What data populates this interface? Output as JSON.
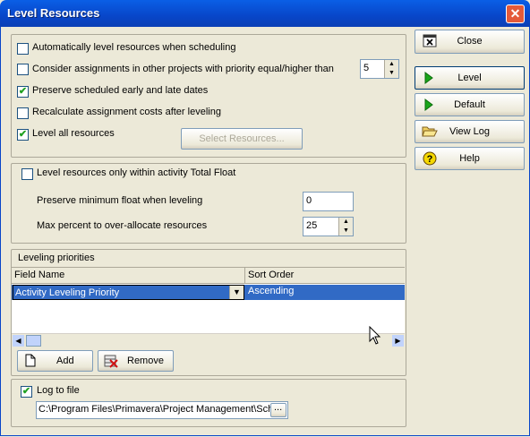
{
  "window": {
    "title": "Level Resources",
    "close_glyph": "✕"
  },
  "options": {
    "auto_level": {
      "label": "Automatically level resources when scheduling",
      "checked": false
    },
    "consider_other_projects": {
      "label": "Consider assignments in other projects with priority equal/higher than",
      "checked": false,
      "priority_value": "5"
    },
    "preserve_dates": {
      "label": "Preserve scheduled early and late dates",
      "checked": true
    },
    "recalculate_costs": {
      "label": "Recalculate assignment costs after leveling",
      "checked": false
    },
    "level_all": {
      "label": "Level all resources",
      "checked": true
    },
    "select_resources_label": "Select Resources..."
  },
  "float": {
    "within_total_float": {
      "label": "Level resources only within activity Total Float",
      "checked": false
    },
    "preserve_min_float_label": "Preserve minimum float when leveling",
    "preserve_min_float_value": "0",
    "max_over_allocate_label": "Max percent to over-allocate resources",
    "max_over_allocate_value": "25"
  },
  "priorities": {
    "section_label": "Leveling priorities",
    "columns": [
      "Field Name",
      "Sort Order"
    ],
    "rows": [
      {
        "field": "Activity Leveling Priority",
        "sort": "Ascending"
      }
    ],
    "add_label": "Add",
    "remove_label": "Remove"
  },
  "log": {
    "label": "Log to file",
    "checked": true,
    "path": "C:\\Program Files\\Primavera\\Project Management\\Sche",
    "browse_label": "..."
  },
  "buttons": {
    "close": "Close",
    "level": "Level",
    "default": "Default",
    "view_log": "View Log",
    "help": "Help"
  },
  "colors": {
    "titlebar": "#0846c9",
    "selection": "#316ac5",
    "dialog_bg": "#ece9d8"
  }
}
